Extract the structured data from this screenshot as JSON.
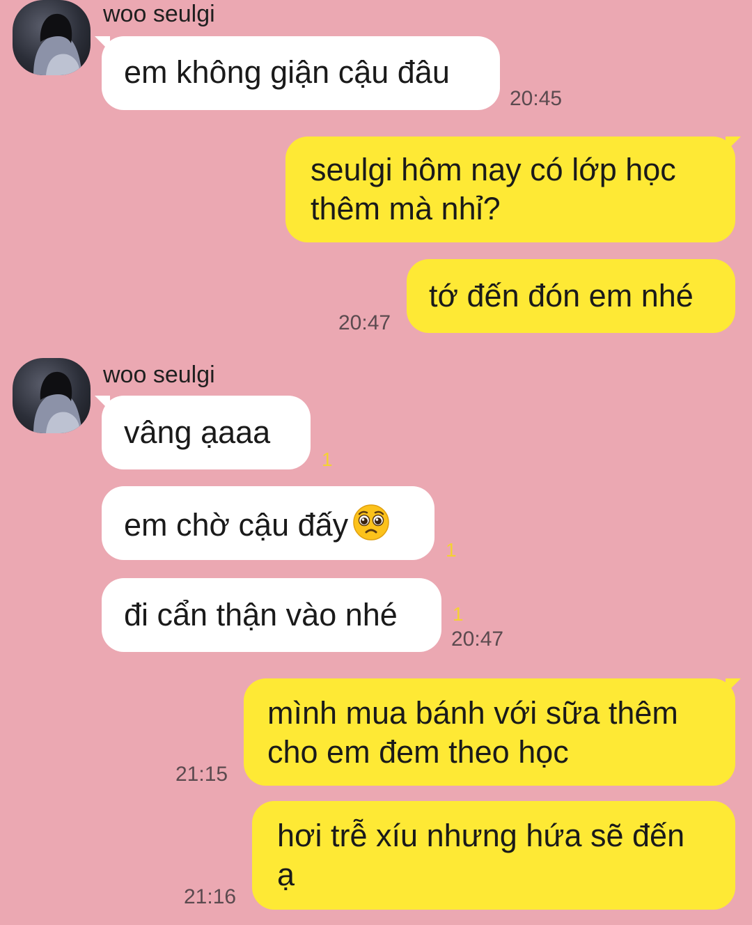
{
  "sender": "woo seulgi",
  "emoji_pleading": "pleading-face-icon",
  "colors": {
    "background": "#eba8b2",
    "incoming_bubble": "#ffffff",
    "outgoing_bubble": "#fee935",
    "unread_count": "#f4d232"
  },
  "groups": [
    {
      "messages": [
        {
          "text": "em không giận cậu đâu",
          "time": "20:45"
        }
      ]
    },
    {
      "messages": [
        {
          "text_lines": [
            "seulgi hôm nay có lớp học",
            "thêm mà nhỉ?"
          ]
        },
        {
          "text": "tớ đến đón em nhé",
          "time": "20:47"
        }
      ]
    },
    {
      "messages": [
        {
          "text": "vâng ạaaa",
          "unread": "1"
        },
        {
          "text": "em chờ cậu đấy",
          "unread": "1"
        },
        {
          "text": "đi cẩn thận vào nhé",
          "unread": "1",
          "time": "20:47"
        }
      ]
    },
    {
      "messages": [
        {
          "text_lines": [
            "mình mua bánh với sữa thêm",
            "cho em đem theo học"
          ],
          "time": "21:15"
        },
        {
          "text_lines": [
            "hơi trễ xíu nhưng hứa sẽ đến",
            "ạ"
          ],
          "time": "21:16"
        }
      ]
    }
  ]
}
